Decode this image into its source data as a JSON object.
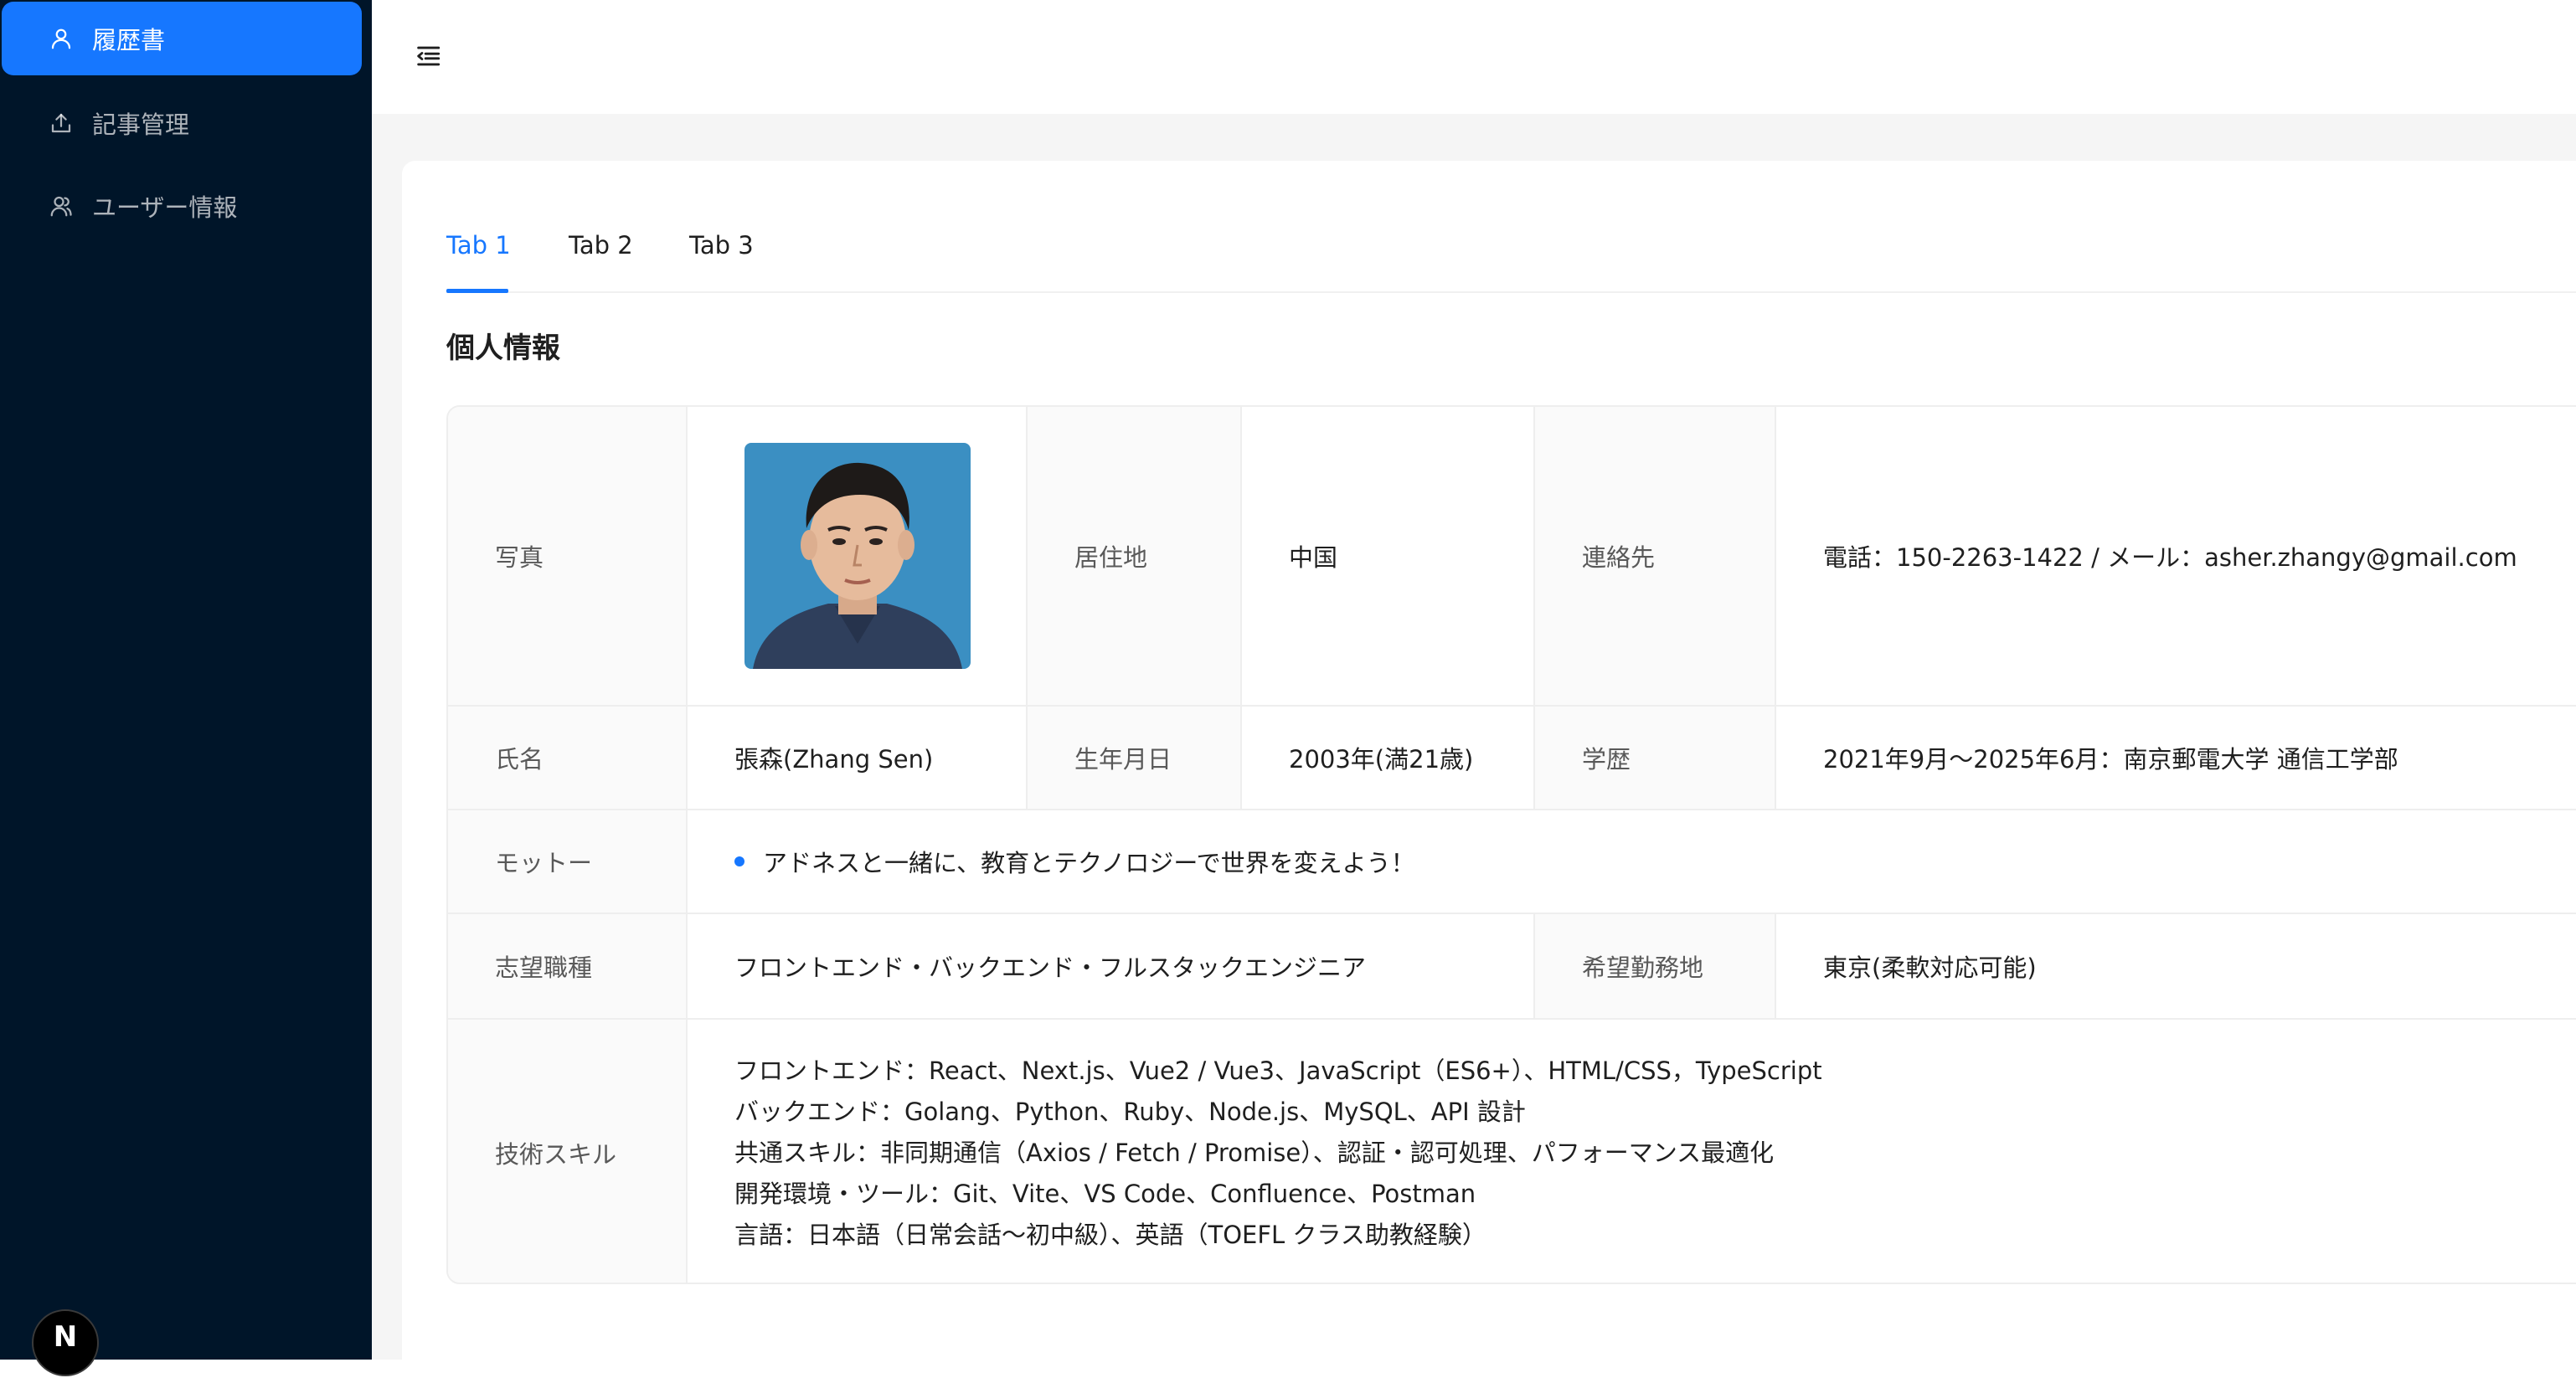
{
  "sidebar": {
    "items": [
      {
        "label": "履歴書",
        "icon": "user-icon",
        "active": true
      },
      {
        "label": "記事管理",
        "icon": "upload-icon",
        "active": false
      },
      {
        "label": "ユーザー情報",
        "icon": "team-icon",
        "active": false
      }
    ],
    "badge": "N"
  },
  "header": {
    "toggle_icon": "menu-fold-icon"
  },
  "tabs": [
    {
      "label": "Tab 1",
      "active": true
    },
    {
      "label": "Tab 2",
      "active": false
    },
    {
      "label": "Tab 3",
      "active": false
    }
  ],
  "section_title": "個人情報",
  "profile": {
    "photo_label": "写真",
    "residence_label": "居住地",
    "residence": "中国",
    "contact_label": "連絡先",
    "contact": "電話：150-2263-1422 / メール：asher.zhangy@gmail.com",
    "name_label": "氏名",
    "name": "張森(Zhang Sen)",
    "birth_label": "生年月日",
    "birth": "2003年(満21歳)",
    "education_label": "学歴",
    "education": "2021年9月〜2025年6月：南京郵電大学 通信工学部",
    "motto_label": "モットー",
    "motto": "アドネスと一緒に、教育とテクノロジーで世界を変えよう！",
    "job_label": "志望職種",
    "job": "フロントエンド・バックエンド・フルスタックエンジニア",
    "location_label": "希望勤務地",
    "location": "東京(柔軟対応可能)",
    "skills_label": "技術スキル",
    "skills": [
      "フロントエンド：React、Next.js、Vue2 / Vue3、JavaScript（ES6+）、HTML/CSS，TypeScript",
      "バックエンド：Golang、Python、Ruby、Node.js、MySQL、API 設計",
      "共通スキル：非同期通信（Axios / Fetch / Promise）、認証・認可処理、パフォーマンス最適化",
      "開発環境・ツール：Git、Vite、VS Code、Confluence、Postman",
      "言語：日本語（日常会話〜初中級）、英語（TOEFL クラス助教経験）"
    ]
  },
  "colors": {
    "sidebar_bg": "#001529",
    "accent": "#1677ff",
    "content_bg": "#f5f5f5"
  }
}
